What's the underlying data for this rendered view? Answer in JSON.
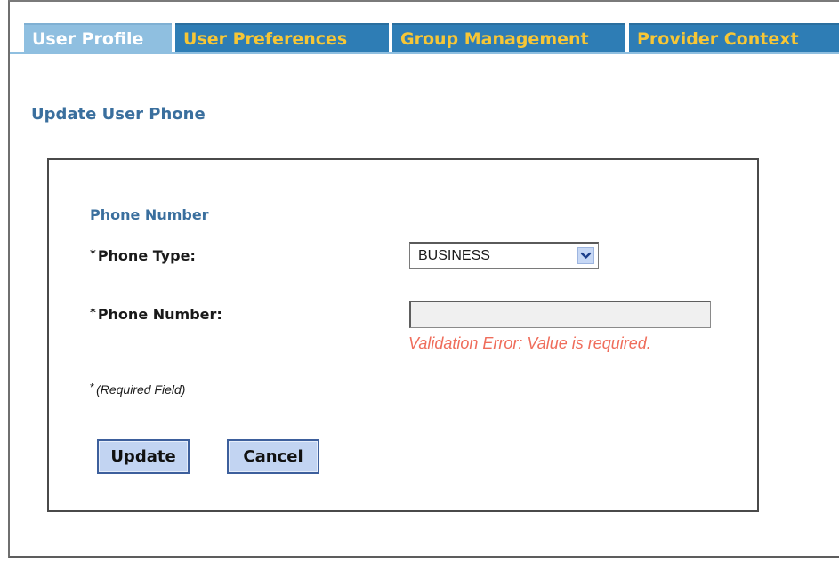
{
  "tabs": [
    {
      "label": "User Profile",
      "active": true
    },
    {
      "label": "User Preferences",
      "active": false
    },
    {
      "label": "Group Management",
      "active": false
    },
    {
      "label": "Provider Context",
      "active": false
    }
  ],
  "page": {
    "title": "Update User Phone"
  },
  "form": {
    "section_title": "Phone Number",
    "required_marker": "*",
    "phone_type": {
      "label": "Phone Type:",
      "selected": "BUSINESS"
    },
    "phone_number": {
      "label": "Phone Number:",
      "value": "",
      "error": "Validation Error: Value is required."
    },
    "required_note": "(Required Field)",
    "buttons": {
      "update": "Update",
      "cancel": "Cancel"
    }
  },
  "colors": {
    "tab_inactive_bg": "#2e7db5",
    "tab_inactive_text": "#f6c636",
    "tab_active_bg": "#8fbfe0",
    "heading": "#3a6f9e",
    "error": "#ef6d5b",
    "button_bg": "#c2d4f2"
  },
  "icons": {
    "select_arrow": "chevron-down-icon"
  }
}
